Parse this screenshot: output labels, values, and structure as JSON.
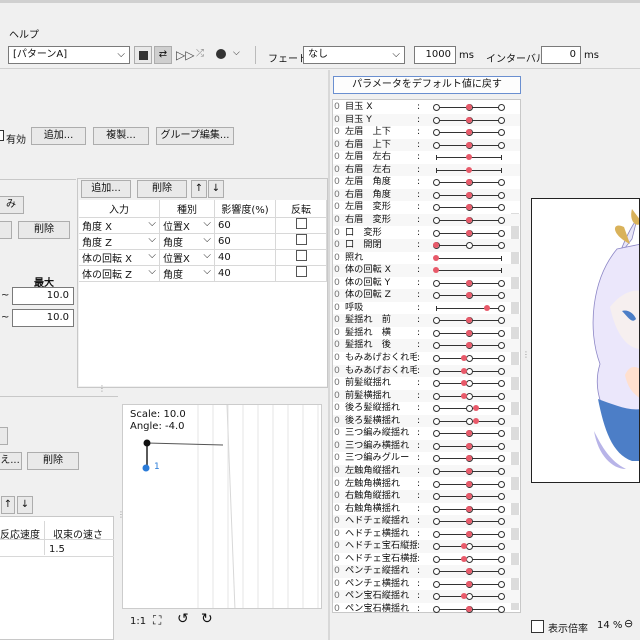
{
  "menu": {
    "help": "ヘルプ"
  },
  "toolbar": {
    "pattern": "[パターンA]",
    "fade_label": "フェード：",
    "fade_value": "なし",
    "ms_value": "1000",
    "ms_unit": "ms",
    "interval_label": "インターバル：",
    "interval_value": "0",
    "interval_unit": "ms"
  },
  "group_bar": {
    "enabled_label": "有効",
    "add": "追加...",
    "duplicate": "複製...",
    "group_edit": "グループ編集..."
  },
  "left_frag": {
    "btn_mi": "み",
    "delete": "削除",
    "max_label": "最大",
    "tilde1": "~",
    "tilde2": "~",
    "val1": "10.0",
    "val2": "10.0"
  },
  "input_panel": {
    "add": "追加...",
    "delete": "削除",
    "up": "↑",
    "down": "↓",
    "headers": [
      "入力",
      "種別",
      "影響度(%)",
      "反転"
    ],
    "rows": [
      {
        "input": "角度 X",
        "kind": "位置X",
        "influence": "60"
      },
      {
        "input": "角度 Z",
        "kind": "角度",
        "influence": "60"
      },
      {
        "input": "体の回転 X",
        "kind": "位置X",
        "influence": "40"
      },
      {
        "input": "体の回転 Z",
        "kind": "角度",
        "influence": "40"
      }
    ]
  },
  "lower_left": {
    "btn_e": "え...",
    "delete": "削除",
    "up": "↑",
    "down": "↓",
    "col_speed": "反応速度",
    "col_conv": "収束の速さ",
    "conv_val": "1.5"
  },
  "preview": {
    "scale": "Scale: 10.0",
    "angle": "Angle: -4.0",
    "point_label": "1",
    "ratio": "1:1"
  },
  "params_header": {
    "reset": "パラメータをデフォルト値に戻す"
  },
  "params": [
    {
      "i": "0",
      "name": "目玉 X"
    },
    {
      "i": "0",
      "name": "目玉 Y"
    },
    {
      "i": "0",
      "name": "左眉　上下"
    },
    {
      "i": "0",
      "name": "右眉　上下"
    },
    {
      "i": "0",
      "name": "左眉　左右"
    },
    {
      "i": "0",
      "name": "右眉　左右"
    },
    {
      "i": "0",
      "name": "左眉　角度"
    },
    {
      "i": "0",
      "name": "右眉　角度"
    },
    {
      "i": "0",
      "name": "左眉　変形"
    },
    {
      "i": "0",
      "name": "右眉　変形"
    },
    {
      "i": "0",
      "name": "口　変形"
    },
    {
      "i": "0",
      "name": "口　開閉"
    },
    {
      "i": "0",
      "name": "照れ"
    },
    {
      "i": "0",
      "name": "体の回転 X"
    },
    {
      "i": "0",
      "name": "体の回転 Y"
    },
    {
      "i": "0",
      "name": "体の回転 Z"
    },
    {
      "i": "0",
      "name": "呼吸"
    },
    {
      "i": "0",
      "name": "髪揺れ　前"
    },
    {
      "i": "0",
      "name": "髪揺れ　横"
    },
    {
      "i": "0",
      "name": "髪揺れ　後"
    },
    {
      "i": "0",
      "name": "もみあげおくれ毛..."
    },
    {
      "i": "0",
      "name": "もみあげおくれ毛..."
    },
    {
      "i": "0",
      "name": "前髪縦揺れ"
    },
    {
      "i": "0",
      "name": "前髪横揺れ"
    },
    {
      "i": "0",
      "name": "後ろ髪縦揺れ"
    },
    {
      "i": "0",
      "name": "後ろ髪横揺れ"
    },
    {
      "i": "0",
      "name": "三つ編み縦揺れ"
    },
    {
      "i": "0",
      "name": "三つ編み横揺れ"
    },
    {
      "i": "0",
      "name": "三つ編みグルー"
    },
    {
      "i": "0",
      "name": "左触角縦揺れ"
    },
    {
      "i": "0",
      "name": "左触角横揺れ"
    },
    {
      "i": "0",
      "name": "右触角縦揺れ"
    },
    {
      "i": "0",
      "name": "右触角横揺れ"
    },
    {
      "i": "0",
      "name": "ヘドチェ縦揺れ"
    },
    {
      "i": "0",
      "name": "ヘドチェ横揺れ"
    },
    {
      "i": "0",
      "name": "ヘドチェ宝石縦揺..."
    },
    {
      "i": "0",
      "name": "ヘドチェ宝石横揺..."
    },
    {
      "i": "0",
      "name": "ペンチェ縦揺れ"
    },
    {
      "i": "0",
      "name": "ペンチェ横揺れ"
    },
    {
      "i": "0",
      "name": "ペン宝石縦揺れ"
    },
    {
      "i": "0",
      "name": "ペン宝石横揺れ"
    }
  ],
  "status": {
    "zoom_label": "表示倍率",
    "zoom_value": "14 %"
  }
}
